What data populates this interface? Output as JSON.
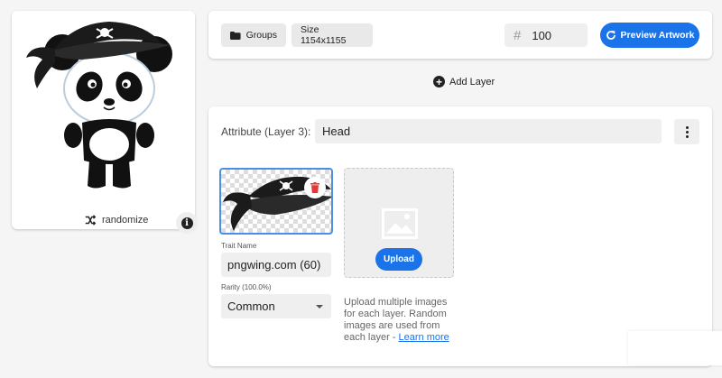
{
  "preview": {
    "randomize_label": "randomize",
    "randomize_icon": "shuffle-icon",
    "info_icon": "info-icon"
  },
  "toolbar": {
    "groups_label": "Groups",
    "size_label": "Size 1154x1155",
    "count_value": "100",
    "preview_label": "Preview Artwork",
    "accent": "#1a73e8"
  },
  "add_layer_label": "Add Layer",
  "layer": {
    "attribute_label": "Attribute (Layer 3):",
    "attribute_value": "Head",
    "trait": {
      "name_label": "Trait Name",
      "name_value": "pngwing.com (60)",
      "rarity_label": "Rarity (100.0%)",
      "rarity_value": "Common"
    },
    "upload": {
      "button_label": "Upload",
      "help_text": "Upload multiple images for each layer. Random images are used from each layer - ",
      "learn_more": "Learn more"
    }
  }
}
